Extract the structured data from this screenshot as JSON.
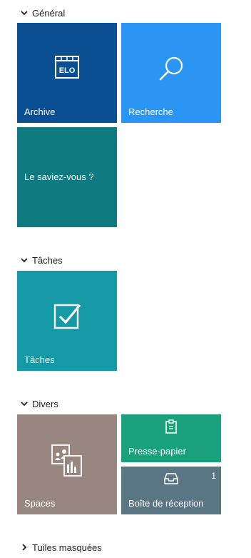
{
  "sections": {
    "general": {
      "title": "Général"
    },
    "taches": {
      "title": "Tâches"
    },
    "divers": {
      "title": "Divers"
    },
    "hidden": {
      "title": "Tuiles masquées"
    }
  },
  "tiles": {
    "archive": {
      "label": "Archive",
      "color": "#0b4f93",
      "icon": "archive-elo-icon",
      "icon_text": "ELO"
    },
    "recherche": {
      "label": "Recherche",
      "color": "#2b95f4",
      "icon": "search-icon"
    },
    "saviez_vous": {
      "label": "Le saviez-vous ?",
      "color": "#0f7a80"
    },
    "taches": {
      "label": "Tâches",
      "color": "#1599a6",
      "icon": "checkbox-icon"
    },
    "spaces": {
      "label": "Spaces",
      "color": "#988680",
      "icon": "spaces-icon"
    },
    "presse_papier": {
      "label": "Presse-papier",
      "color": "#1aa07c",
      "icon": "clipboard-icon"
    },
    "boite_reception": {
      "label": "Boîte de réception",
      "color": "#5a7584",
      "icon": "inbox-icon",
      "count": "1"
    }
  }
}
